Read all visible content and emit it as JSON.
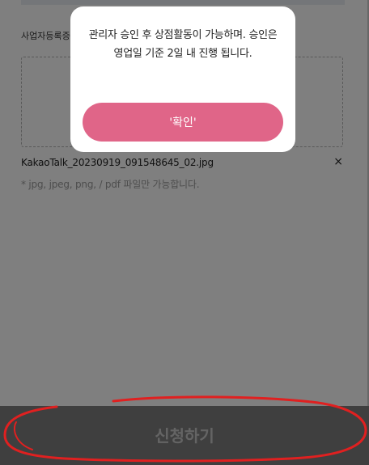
{
  "form": {
    "section_label": "사업자등록증",
    "file_name": "KakaoTalk_20230919_091548645_02.jpg",
    "remove_icon": "×",
    "hint": "* jpg, jpeg, png, / pdf 파일만 가능합니다."
  },
  "footer": {
    "submit_label": "신청하기"
  },
  "modal": {
    "message": "관리자 승인 후 상점활동이 가능하며. 승인은 영업일 기준 2일 내 진행 됩니다.",
    "confirm_label": "'확인'"
  },
  "colors": {
    "accent": "#e06588",
    "annotation": "#e02020",
    "overlay": "rgba(0,0,0,0.5)"
  }
}
